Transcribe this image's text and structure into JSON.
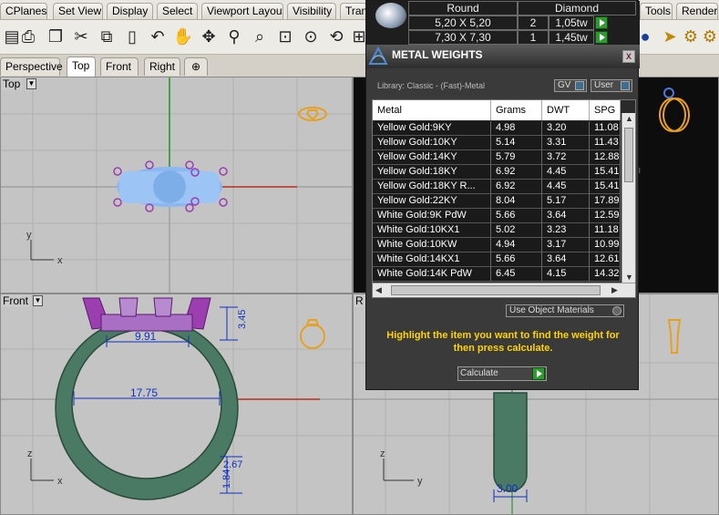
{
  "menubar": {
    "items": [
      "CPlanes",
      "Set View",
      "Display",
      "Select",
      "Viewport Layout",
      "Visibility",
      "Trans",
      "Tools",
      "Render"
    ]
  },
  "toolbar": {
    "tools": [
      "new-file-icon",
      "print-icon",
      "open-icon",
      "cut-icon",
      "copy-icon",
      "paste-icon",
      "undo-icon",
      "pan-hand-icon",
      "move-icon",
      "zoom-icon",
      "zoom-window-icon",
      "zoom-extents-icon",
      "zoom-selected-icon",
      "rotate-icon",
      "settings-gear-icon"
    ]
  },
  "viewport_tabs": [
    "Perspective",
    "Top",
    "Front",
    "Right"
  ],
  "viewports": {
    "top": {
      "label": "Top"
    },
    "front": {
      "label": "Front"
    },
    "right": {
      "label": "R"
    },
    "dims": {
      "ring_inner": "9.91",
      "ring_diameter": "17.75",
      "height_a": "3.45",
      "height_b": "2.67",
      "height_c": "1.84",
      "shank_width": "3.00"
    }
  },
  "diamond_grid": {
    "header": {
      "shape": "Round",
      "material": "Diamond"
    },
    "rows": [
      {
        "size": "5,20 X 5,20",
        "qty": "2",
        "carat": "1,05tw"
      },
      {
        "size": "7,30 X 7,30",
        "qty": "1",
        "carat": "1,45tw"
      }
    ]
  },
  "metal_dialog": {
    "title": "METAL WEIGHTS",
    "close_label": "x",
    "library": "Library: Classic - (Fast)-Metal",
    "gv_label": "GV",
    "user_label": "User",
    "columns": [
      "Metal",
      "Grams",
      "DWT",
      "SPG"
    ],
    "rows": [
      {
        "metal": "Yellow Gold:9KY",
        "grams": "4.98",
        "dwt": "3.20",
        "spg": "11.08"
      },
      {
        "metal": "Yellow Gold:10KY",
        "grams": "5.14",
        "dwt": "3.31",
        "spg": "11.43"
      },
      {
        "metal": "Yellow Gold:14KY",
        "grams": "5.79",
        "dwt": "3.72",
        "spg": "12.88"
      },
      {
        "metal": "Yellow Gold:18KY",
        "grams": "6.92",
        "dwt": "4.45",
        "spg": "15.41"
      },
      {
        "metal": "Yellow Gold:18KY R...",
        "grams": "6.92",
        "dwt": "4.45",
        "spg": "15.41"
      },
      {
        "metal": "Yellow Gold:22KY",
        "grams": "8.04",
        "dwt": "5.17",
        "spg": "17.89"
      },
      {
        "metal": "White Gold:9K PdW",
        "grams": "5.66",
        "dwt": "3.64",
        "spg": "12.59"
      },
      {
        "metal": "White Gold:10KX1",
        "grams": "5.02",
        "dwt": "3.23",
        "spg": "11.18"
      },
      {
        "metal": "White Gold:10KW",
        "grams": "4.94",
        "dwt": "3.17",
        "spg": "10.99"
      },
      {
        "metal": "White Gold:14KX1",
        "grams": "5.66",
        "dwt": "3.64",
        "spg": "12.61"
      },
      {
        "metal": "White Gold:14K PdW",
        "grams": "6.45",
        "dwt": "4.15",
        "spg": "14.32"
      }
    ],
    "use_object_materials": "Use Object Materials",
    "hint": "Highlight the item you want to find the weight for then press calculate.",
    "calculate_label": "Calculate"
  },
  "colors": {
    "dialog_bg": "#3a3a3a",
    "accent_green": "#2f9a2f",
    "hint_yellow": "#ffd400",
    "ring_green": "#4a7a64",
    "prong_purple": "#9b3fb0",
    "viewport_grey": "#c4c4c4",
    "axis_red": "#c0301e",
    "axis_green": "#1e9a2e"
  }
}
